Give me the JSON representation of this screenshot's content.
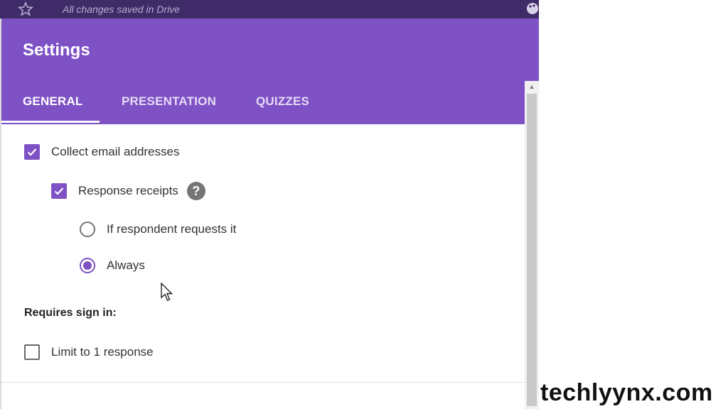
{
  "topbar": {
    "saved_text": "All changes saved in Drive",
    "icons": [
      "star-icon",
      "palette-icon"
    ]
  },
  "dialog": {
    "title": "Settings",
    "tabs": [
      {
        "label": "GENERAL",
        "active": true
      },
      {
        "label": "PRESENTATION",
        "active": false
      },
      {
        "label": "QUIZZES",
        "active": false
      }
    ],
    "collect_email": {
      "label": "Collect email addresses",
      "checked": true
    },
    "response_receipts": {
      "label": "Response receipts",
      "checked": true,
      "help_icon": "help-icon"
    },
    "receipt_options": [
      {
        "label": "If respondent requests it",
        "selected": false
      },
      {
        "label": "Always",
        "selected": true
      }
    ],
    "requires_sign_in": {
      "label": "Requires sign in:"
    },
    "limit_response": {
      "label": "Limit to 1 response",
      "checked": false
    }
  },
  "watermark": "techlyynx.com",
  "colors": {
    "accent": "#7e51c5",
    "topbar": "#3f2b67"
  }
}
